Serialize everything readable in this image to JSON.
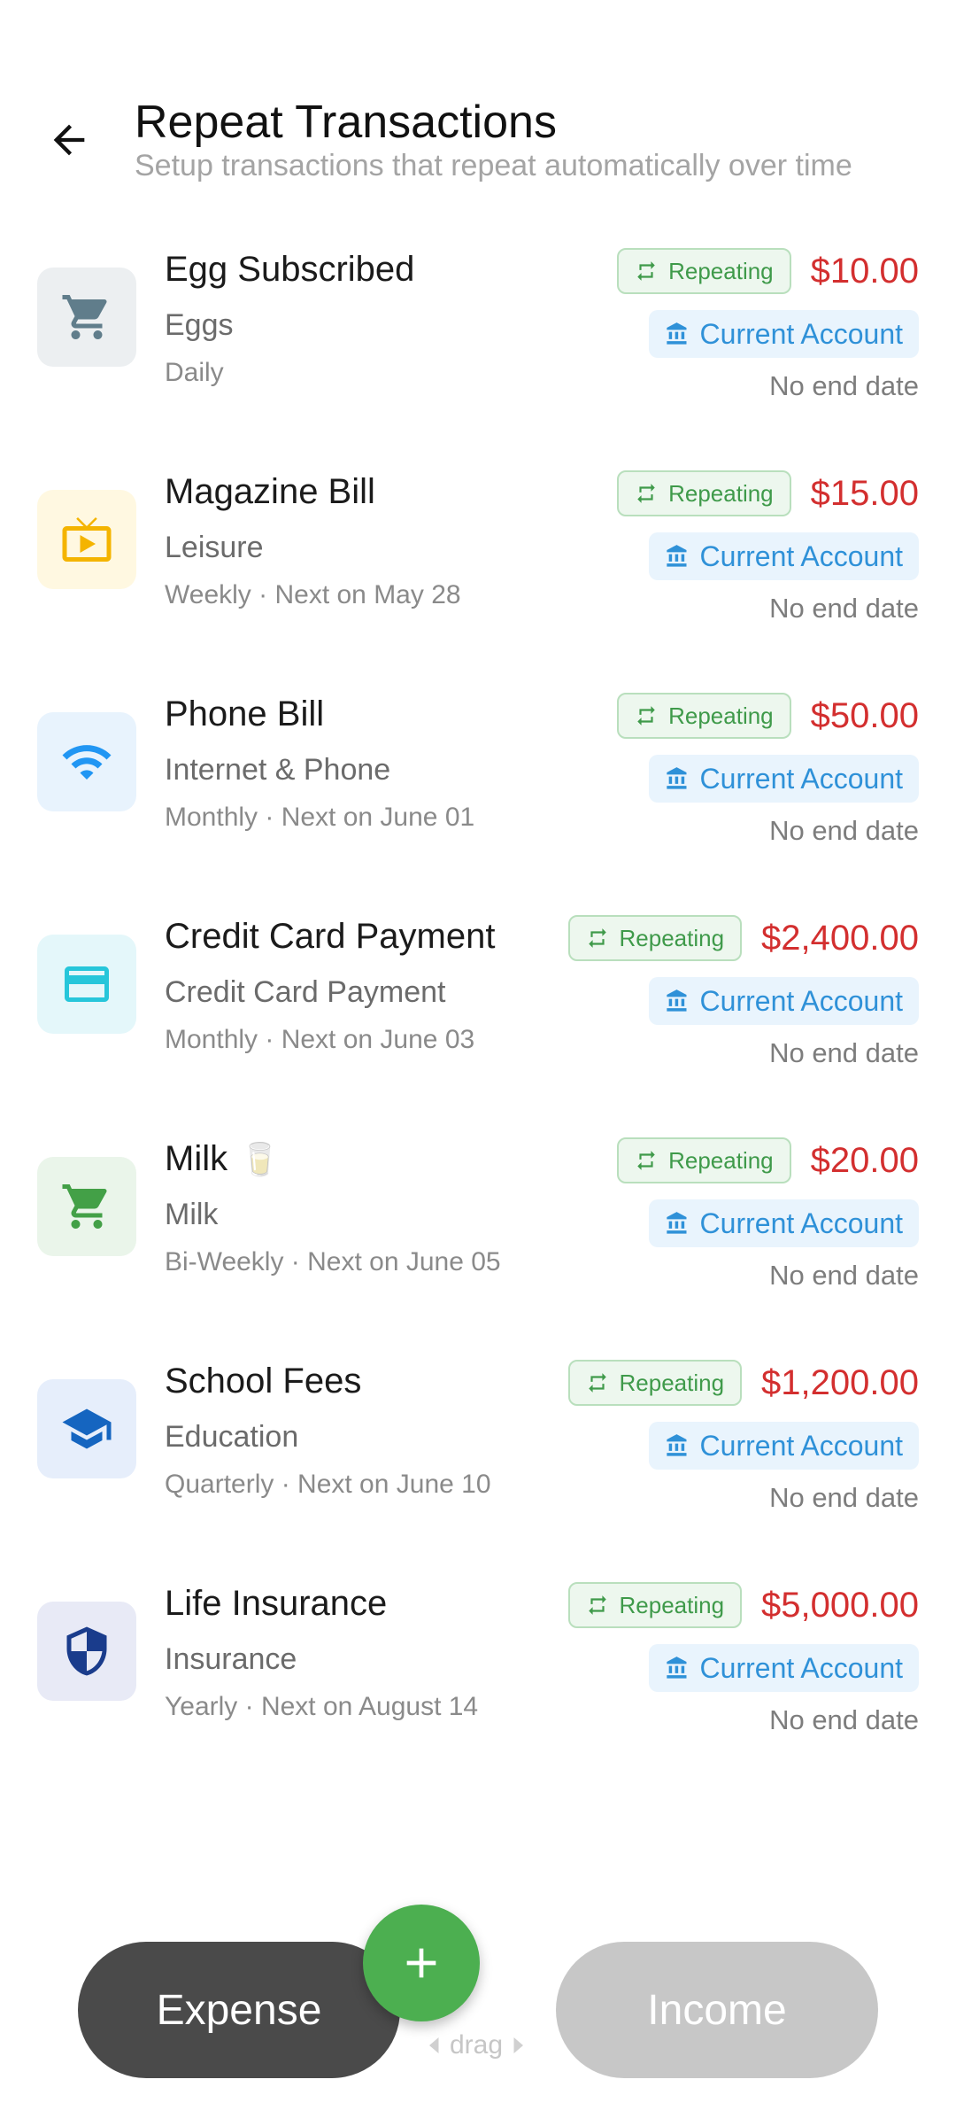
{
  "header": {
    "title": "Repeat Transactions",
    "subtitle": "Setup transactions that repeat automatically over time"
  },
  "colors": {
    "expense_amount": "#d32f2f",
    "repeating_green": "#3f9a4a",
    "account_blue": "#2f91d8",
    "fab_green": "#4caf50"
  },
  "transactions": [
    {
      "name": "Egg Subscribed",
      "emoji": "",
      "category": "Eggs",
      "schedule": "Daily",
      "badge": "Repeating",
      "amount": "$10.00",
      "account": "Current Account",
      "end": "No end date",
      "icon": "cart-icon"
    },
    {
      "name": "Magazine Bill",
      "emoji": "",
      "category": "Leisure",
      "schedule": "Weekly · Next on May 28",
      "badge": "Repeating",
      "amount": "$15.00",
      "account": "Current Account",
      "end": "No end date",
      "icon": "tv-icon"
    },
    {
      "name": "Phone Bill",
      "emoji": "",
      "category": "Internet & Phone",
      "schedule": "Monthly · Next on June 01",
      "badge": "Repeating",
      "amount": "$50.00",
      "account": "Current Account",
      "end": "No end date",
      "icon": "wifi-icon"
    },
    {
      "name": "Credit Card Payment",
      "emoji": "",
      "category": "Credit Card Payment",
      "schedule": "Monthly · Next on June 03",
      "badge": "Repeating",
      "amount": "$2,400.00",
      "account": "Current Account",
      "end": "No end date",
      "icon": "credit-card-icon"
    },
    {
      "name": "Milk",
      "emoji": "🥛",
      "category": "Milk",
      "schedule": "Bi-Weekly · Next on June 05",
      "badge": "Repeating",
      "amount": "$20.00",
      "account": "Current Account",
      "end": "No end date",
      "icon": "cart-icon"
    },
    {
      "name": "School Fees",
      "emoji": "",
      "category": "Education",
      "schedule": "Quarterly · Next on June 10",
      "badge": "Repeating",
      "amount": "$1,200.00",
      "account": "Current Account",
      "end": "No end date",
      "icon": "graduation-cap-icon"
    },
    {
      "name": "Life Insurance",
      "emoji": "",
      "category": "Insurance",
      "schedule": "Yearly · Next on August 14",
      "badge": "Repeating",
      "amount": "$5,000.00",
      "account": "Current Account",
      "end": "No end date",
      "icon": "shield-icon"
    }
  ],
  "bottom": {
    "expense_label": "Expense",
    "income_label": "Income",
    "drag_label": "drag"
  }
}
